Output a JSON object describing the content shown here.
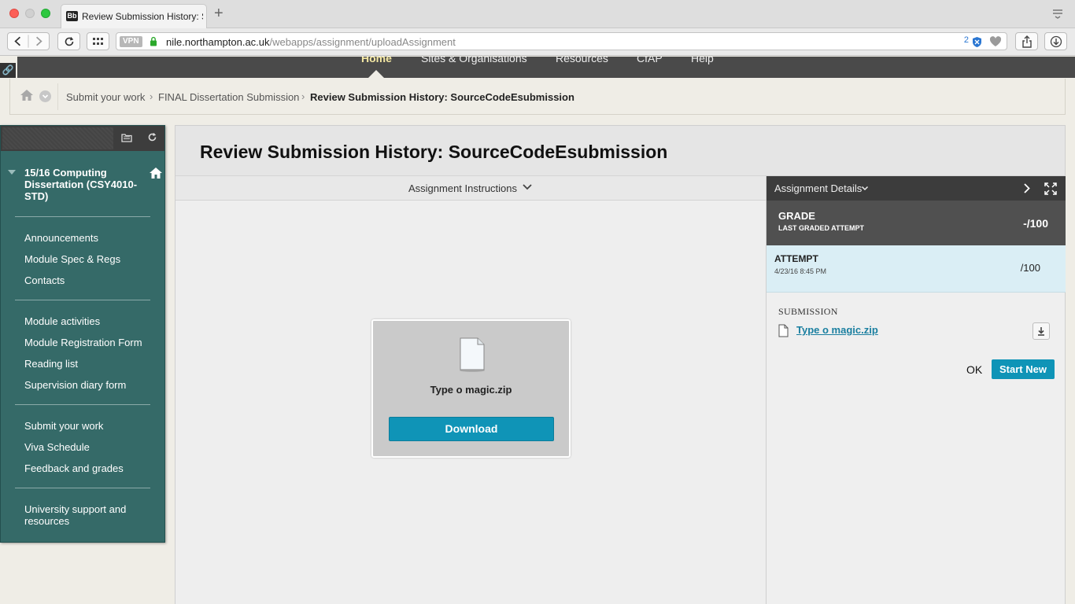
{
  "browser": {
    "tab_title": "Review Submission History: S",
    "tab_favicon": "Bb",
    "new_tab": "+",
    "vpn_label": "VPN",
    "url_host": "nile.northampton.ac.uk",
    "url_path": "/webapps/assignment/uploadAssignment",
    "extension_count": "2"
  },
  "topnav": {
    "items": [
      "Home",
      "Sites & Organisations",
      "Resources",
      "CfAP",
      "Help"
    ]
  },
  "breadcrumb": {
    "items": [
      "Submit your work",
      "FINAL Dissertation Submission"
    ],
    "current": "Review Submission History: SourceCodeEsubmission"
  },
  "course_menu": {
    "course_title": "15/16 Computing Dissertation (CSY4010-STD)",
    "groups": [
      [
        "Announcements",
        "Module Spec & Regs",
        "Contacts"
      ],
      [
        "Module activities",
        "Module Registration Form",
        "Reading list",
        "Supervision diary form"
      ],
      [
        "Submit your work",
        "Viva Schedule",
        "Feedback and grades"
      ],
      [
        "University support and resources"
      ]
    ]
  },
  "content": {
    "title": "Review Submission History: SourceCodeEsubmission",
    "instructions_label": "Assignment Instructions",
    "file_name": "Type o magic.zip",
    "download_label": "Download"
  },
  "details": {
    "header": "Assignment Details",
    "grade_label": "GRADE",
    "grade_sub": "LAST GRADED ATTEMPT",
    "grade_value": "-/100",
    "attempt_label": "ATTEMPT",
    "attempt_date": "4/23/16 8:45 PM",
    "attempt_value": "/100",
    "submission_label": "SUBMISSION",
    "submission_file": "Type o magic.zip",
    "ok_label": "OK",
    "start_new_label": "Start New"
  },
  "colors": {
    "course_menu_bg": "#356a68",
    "accent_button": "#0f94b7",
    "nav_bg": "#4a4a4a",
    "attempt_bg": "#daeef5"
  }
}
